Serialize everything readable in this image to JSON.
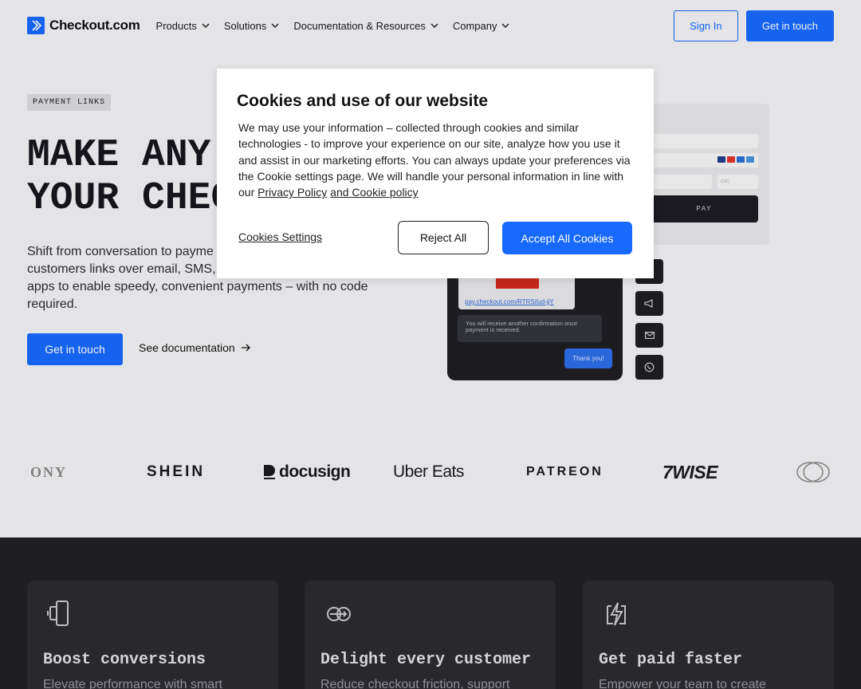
{
  "header": {
    "logo_text": "Checkout.com",
    "nav": [
      {
        "label": "Products"
      },
      {
        "label": "Solutions"
      },
      {
        "label": "Documentation & Resources"
      },
      {
        "label": "Company"
      }
    ],
    "sign_in_label": "Sign In",
    "get_in_touch_label": "Get in touch"
  },
  "hero": {
    "tag": "PAYMENT LINKS",
    "title": "MAKE ANY C\nYOUR CHEC",
    "description": "Shift from conversation to payme customers links over email, SMS, apps to enable speedy, convenient payments – with no code required.",
    "description_lines": [
      "Shift from conversation to payme",
      "customers links over email, SMS,",
      "apps to enable speedy, convenient payments – with no code",
      "required."
    ],
    "cta_label": "Get in touch",
    "docs_label": "See documentation"
  },
  "illustration": {
    "pay_button_label": "PAY",
    "payment_link": "pay.checkout.com/RTRSilud-jjY",
    "confirmation_message": "You will receive another confirmation once payment is received.",
    "reply_message": "Thank you!",
    "field_cvc": "CVC"
  },
  "logos": [
    "ONY",
    "SHEIN",
    "docusign",
    "Uber Eats",
    "PATREON",
    "7WISE"
  ],
  "features": [
    {
      "title": "Boost conversions",
      "desc": "Elevate performance with smart"
    },
    {
      "title": "Delight every customer",
      "desc": "Reduce checkout friction, support"
    },
    {
      "title": "Get paid faster",
      "desc": "Empower your team to create"
    }
  ],
  "cookie_modal": {
    "title": "Cookies and use of our website",
    "body": "We may use your information – collected through cookies and similar technologies - to improve your experience on our site, analyze how you use it and assist in our marketing efforts. You can always update your preferences via the Cookie settings page. We will handle your personal information in line with our",
    "privacy_link": "Privacy Policy",
    "cookie_link": "and Cookie policy",
    "settings_label": "Cookies Settings",
    "reject_label": "Reject All",
    "accept_label": "Accept All Cookies"
  },
  "colors": {
    "brand_blue": "#186aff",
    "background": "#f3f3f5",
    "dark_section": "#212125"
  }
}
